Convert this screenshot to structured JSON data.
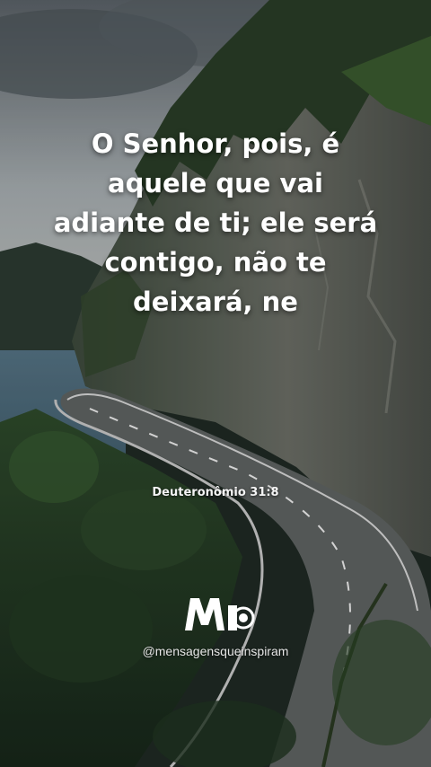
{
  "quote": {
    "text": "O Senhor, pois, é\naquele que vai\nadiante de ti; ele será\ncontigo, não te\ndeixará, ne"
  },
  "reference": "Deuteronômio 31:8",
  "brand": {
    "logo_icon": "mi-logo-icon",
    "handle": "@mensagensqueinspiram"
  },
  "colors": {
    "sky": "#9aa3a8",
    "lake": "#3e5d6e",
    "cliff": "#5c6259",
    "foliage": "#2f4a2c",
    "road": "#5f6462"
  }
}
